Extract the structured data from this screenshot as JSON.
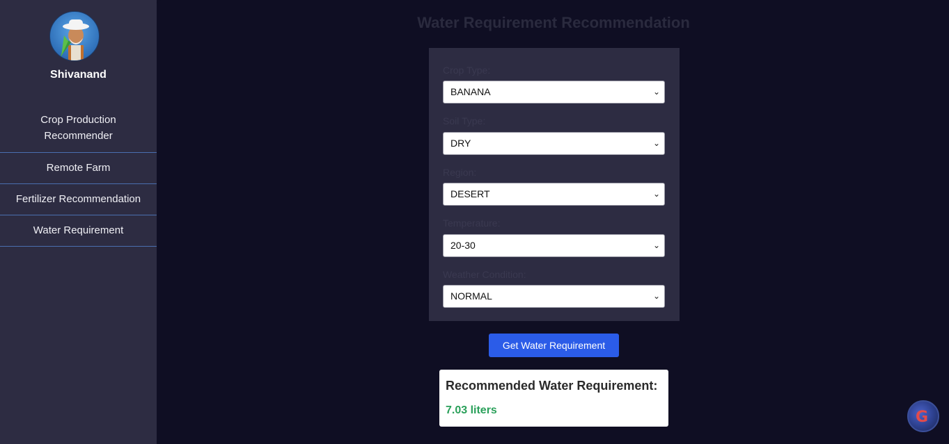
{
  "sidebar": {
    "username": "Shivanand",
    "nav": [
      {
        "label": "Crop Production Recommender"
      },
      {
        "label": "Remote Farm"
      },
      {
        "label": "Fertilizer Recommendation"
      },
      {
        "label": "Water Requirement"
      }
    ]
  },
  "main": {
    "title": "Water Requirement Recommendation",
    "form": {
      "fields": [
        {
          "label": "Crop Type:",
          "value": "BANANA"
        },
        {
          "label": "Soil Type:",
          "value": "DRY"
        },
        {
          "label": "Region:",
          "value": "DESERT"
        },
        {
          "label": "Temperature:",
          "value": "20-30"
        },
        {
          "label": "Weather Condition:",
          "value": "NORMAL"
        }
      ],
      "submit_label": "Get Water Requirement"
    },
    "result": {
      "title": "Recommended Water Requirement:",
      "value": "7.03 liters"
    }
  },
  "colors": {
    "sidebar_bg": "#2d2c42",
    "main_bg": "#0f0e23",
    "accent": "#2b5ce8",
    "result_value": "#2aa05a"
  },
  "icons": {
    "avatar": "farmer-avatar-icon",
    "select_arrow": "chevron-down-icon",
    "corner": "translate-badge-icon"
  }
}
